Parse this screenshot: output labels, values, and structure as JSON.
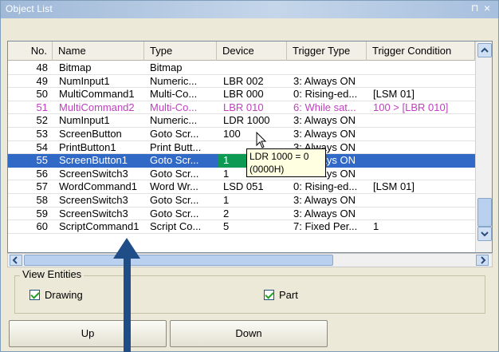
{
  "window": {
    "title": "Object List",
    "pin_glyph": "⊓",
    "close_glyph": "×"
  },
  "list": {
    "columns": [
      "No.",
      "Name",
      "Type",
      "Device",
      "Trigger Type",
      "Trigger Condition"
    ],
    "rows": [
      {
        "no": "48",
        "name": "Bitmap",
        "type": "Bitmap",
        "device": "",
        "trigger_type": "",
        "trigger_condition": ""
      },
      {
        "no": "49",
        "name": "NumInput1",
        "type": "Numeric...",
        "device": "LBR 002",
        "trigger_type": "3: Always ON",
        "trigger_condition": ""
      },
      {
        "no": "50",
        "name": "MultiCommand1",
        "type": "Multi-Co...",
        "device": "LBR 000",
        "trigger_type": "0: Rising-ed...",
        "trigger_condition": "[LSM 01]"
      },
      {
        "no": "51",
        "name": "MultiCommand2",
        "type": "Multi-Co...",
        "device": "LBR 010",
        "trigger_type": "6: While sat...",
        "trigger_condition": "100 > [LBR 010]"
      },
      {
        "no": "52",
        "name": "NumInput1",
        "type": "Numeric...",
        "device": "LDR 1000",
        "trigger_type": "3: Always ON",
        "trigger_condition": ""
      },
      {
        "no": "53",
        "name": "ScreenButton",
        "type": "Goto Scr...",
        "device": "100",
        "trigger_type": "3: Always ON",
        "trigger_condition": ""
      },
      {
        "no": "54",
        "name": "PrintButton1",
        "type": "Print Butt...",
        "device": "",
        "trigger_type": "3: Always ON",
        "trigger_condition": ""
      },
      {
        "no": "55",
        "name": "ScreenButton1",
        "type": "Goto Scr...",
        "device": "1",
        "trigger_type": "3: Always ON",
        "trigger_condition": ""
      },
      {
        "no": "56",
        "name": "ScreenSwitch3",
        "type": "Goto Scr...",
        "device": "1",
        "trigger_type": "3: Always ON",
        "trigger_condition": ""
      },
      {
        "no": "57",
        "name": "WordCommand1",
        "type": "Word Wr...",
        "device": "LSD 051",
        "trigger_type": "0: Rising-ed...",
        "trigger_condition": "[LSM 01]"
      },
      {
        "no": "58",
        "name": "ScreenSwitch3",
        "type": "Goto Scr...",
        "device": "1",
        "trigger_type": "3: Always ON",
        "trigger_condition": ""
      },
      {
        "no": "59",
        "name": "ScreenSwitch3",
        "type": "Goto Scr...",
        "device": "2",
        "trigger_type": "3: Always ON",
        "trigger_condition": ""
      },
      {
        "no": "60",
        "name": "ScriptCommand1",
        "type": "Script Co...",
        "device": "5",
        "trigger_type": "7: Fixed Per...",
        "trigger_condition": "1"
      }
    ],
    "selected_no": "55",
    "tooltip": {
      "line1": "LDR 1000 = 0",
      "line2": "(0000H)"
    }
  },
  "view_entities": {
    "label": "View Entities",
    "checkboxes": [
      {
        "label": "Drawing",
        "checked": true
      },
      {
        "label": "Part",
        "checked": true
      }
    ]
  },
  "buttons": {
    "up": "Up",
    "down": "Down"
  },
  "colors": {
    "selection": "#3169c6",
    "highlight_row": "#c040c0",
    "annotation_arrow": "#1f4d87"
  }
}
